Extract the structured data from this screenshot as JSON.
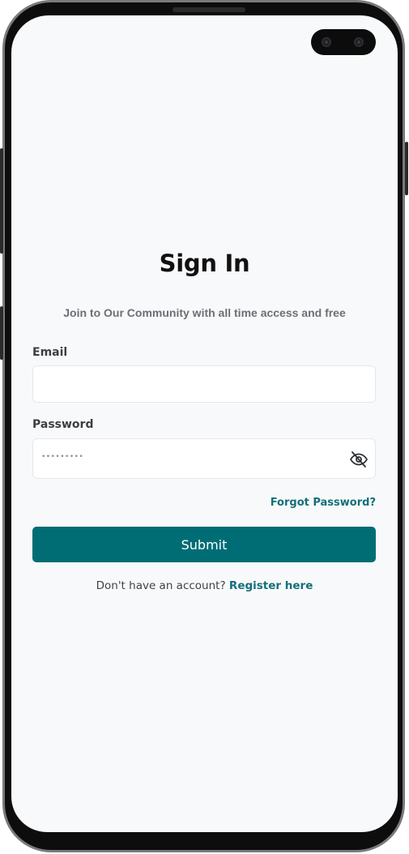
{
  "signin": {
    "title": "Sign In",
    "subtitle": "Join to Our Community with all time access and free"
  },
  "form": {
    "email_label": "Email",
    "email_value": "",
    "password_label": "Password",
    "password_mask": "•••••••••",
    "password_toggle_icon": "eye-off-icon"
  },
  "links": {
    "forgot_password": "Forgot Password?"
  },
  "actions": {
    "submit_label": "Submit"
  },
  "footer": {
    "prompt": "Don't have an account?",
    "register_link": "Register here"
  },
  "colors": {
    "accent": "#006d74",
    "link": "#136f7b",
    "background": "#f8f9fa"
  }
}
